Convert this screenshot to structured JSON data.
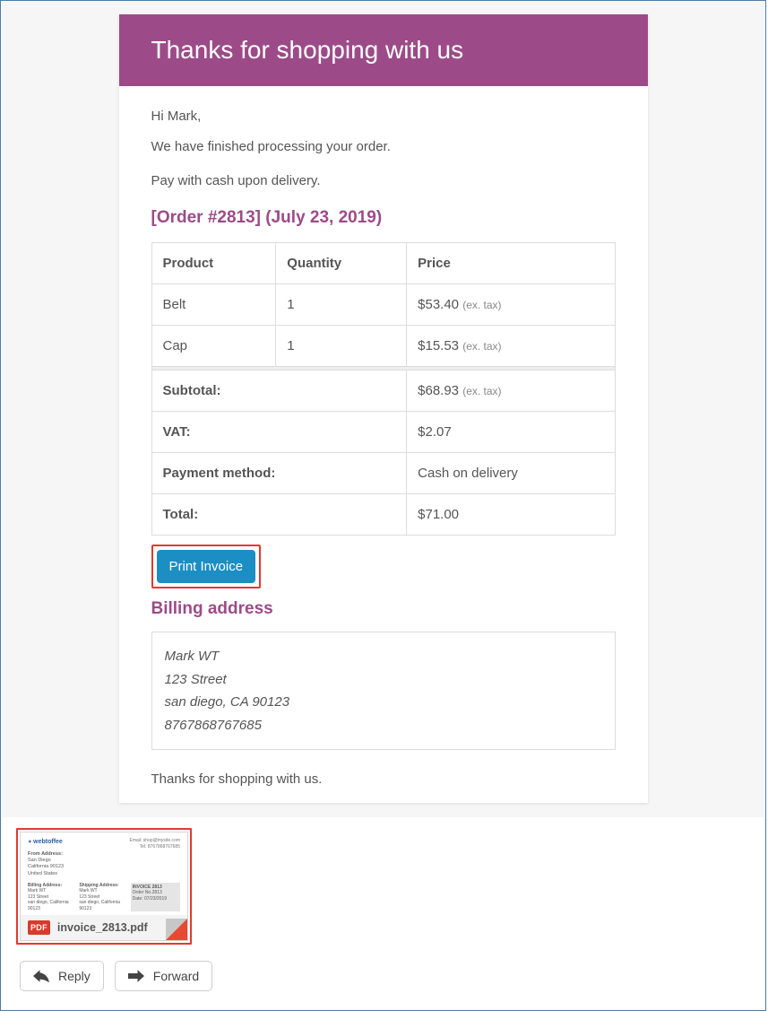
{
  "header": {
    "title": "Thanks for shopping with us"
  },
  "body": {
    "greeting": "Hi Mark,",
    "processed": "We have finished processing your order.",
    "payline": "Pay with cash upon delivery.",
    "order_heading": "[Order #2813] (July 23, 2019)",
    "columns": {
      "product": "Product",
      "quantity": "Quantity",
      "price": "Price"
    },
    "items": [
      {
        "product": "Belt",
        "quantity": "1",
        "price": "$53.40",
        "extax": "(ex. tax)"
      },
      {
        "product": "Cap",
        "quantity": "1",
        "price": "$15.53",
        "extax": "(ex. tax)"
      }
    ],
    "totals": {
      "subtotal_label": "Subtotal:",
      "subtotal_value": "$68.93",
      "subtotal_extax": "(ex. tax)",
      "vat_label": "VAT:",
      "vat_value": "$2.07",
      "payment_label": "Payment method:",
      "payment_value": "Cash on delivery",
      "total_label": "Total:",
      "total_value": "$71.00"
    },
    "print_btn": "Print Invoice",
    "billing_heading": "Billing address",
    "billing": {
      "name": "Mark WT",
      "street": "123 Street",
      "city": "san diego, CA 90123",
      "phone": "8767868767685"
    },
    "thanks": "Thanks for shopping with us."
  },
  "attachment": {
    "filename": "invoice_2813.pdf",
    "pdf_badge": "PDF",
    "brand": "webtoffee",
    "email_line": "Email: shop@mysite.com",
    "tel_line": "Tel: 8767868767685",
    "from_title": "From Address:",
    "from_l1": "San Diego",
    "from_l2": "California 90123",
    "from_l3": "United States",
    "bill_title": "Billing Address:",
    "bill_l1": "Mark WT",
    "bill_l2": "123 Street",
    "bill_l3": "san diego, California 90123",
    "ship_title": "Shipping Address:",
    "ship_l1": "Mark WT",
    "ship_l2": "123 Street",
    "ship_l3": "san diego, California 90123",
    "inv_title": "INVOICE 2813",
    "inv_l1": "Order No.2813",
    "inv_l2": "Date: 07/23/2019"
  },
  "actions": {
    "reply": "Reply",
    "forward": "Forward"
  }
}
